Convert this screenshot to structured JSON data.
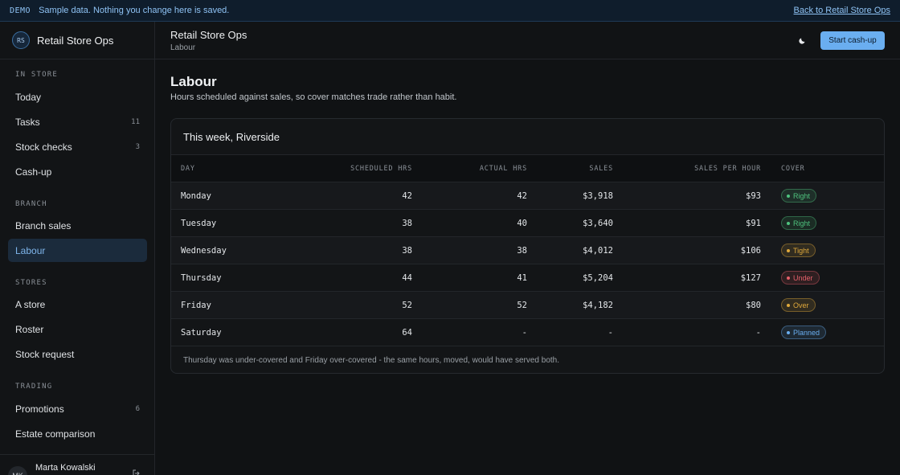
{
  "banner": {
    "tag": "DEMO",
    "message": "Sample data. Nothing you change here is saved.",
    "back_link": "Back to Retail Store Ops"
  },
  "sidebar": {
    "brand_initials": "RS",
    "brand_name": "Retail Store Ops",
    "sections": [
      {
        "label": "IN STORE"
      },
      {
        "label": "BRANCH"
      },
      {
        "label": "STORES"
      },
      {
        "label": "TRADING"
      }
    ],
    "items": [
      {
        "label": "Today",
        "count": ""
      },
      {
        "label": "Tasks",
        "count": "11"
      },
      {
        "label": "Stock checks",
        "count": "3"
      },
      {
        "label": "Cash-up",
        "count": ""
      },
      {
        "label": "Branch sales",
        "count": ""
      },
      {
        "label": "Labour",
        "count": "",
        "active": true
      },
      {
        "label": "A store",
        "count": ""
      },
      {
        "label": "Roster",
        "count": ""
      },
      {
        "label": "Stock request",
        "count": ""
      },
      {
        "label": "Promotions",
        "count": "6"
      },
      {
        "label": "Estate comparison",
        "count": ""
      }
    ],
    "user": {
      "initials": "MK",
      "name": "Marta Kowalski",
      "icon": "logout-icon"
    }
  },
  "header": {
    "title": "Retail Store Ops",
    "subtitle": "Labour",
    "theme_icon": "moon-icon",
    "cta_label": "Start cash-up"
  },
  "main": {
    "title": "Labour",
    "description": "Hours scheduled against sales, so cover matches trade rather than habit."
  },
  "card": {
    "title": "This week, Riverside",
    "columns": [
      "DAY",
      "SCHEDULED HRS",
      "ACTUAL HRS",
      "SALES",
      "SALES PER HOUR",
      "COVER"
    ],
    "rows": [
      {
        "day": "Monday",
        "scheduled": "42",
        "actual": "42",
        "sales": "$3,918",
        "sph": "$93",
        "cover": "Right",
        "status": "right"
      },
      {
        "day": "Tuesday",
        "scheduled": "38",
        "actual": "40",
        "sales": "$3,640",
        "sph": "$91",
        "cover": "Right",
        "status": "right"
      },
      {
        "day": "Wednesday",
        "scheduled": "38",
        "actual": "38",
        "sales": "$4,012",
        "sph": "$106",
        "cover": "Tight",
        "status": "tight"
      },
      {
        "day": "Thursday",
        "scheduled": "44",
        "actual": "41",
        "sales": "$5,204",
        "sph": "$127",
        "cover": "Under",
        "status": "under"
      },
      {
        "day": "Friday",
        "scheduled": "52",
        "actual": "52",
        "sales": "$4,182",
        "sph": "$80",
        "cover": "Over",
        "status": "over"
      },
      {
        "day": "Saturday",
        "scheduled": "64",
        "actual": "-",
        "sales": "-",
        "sph": "-",
        "cover": "Planned",
        "status": "planned"
      }
    ],
    "footnote": "Thursday was under-covered and Friday over-covered - the same hours, moved, would have served both."
  },
  "colors": {
    "accent": "#6aaef0",
    "right": "#4fc37e",
    "tight": "#e0a93b",
    "under": "#e5606a",
    "over": "#e0a93b",
    "planned": "#6aaef0"
  }
}
